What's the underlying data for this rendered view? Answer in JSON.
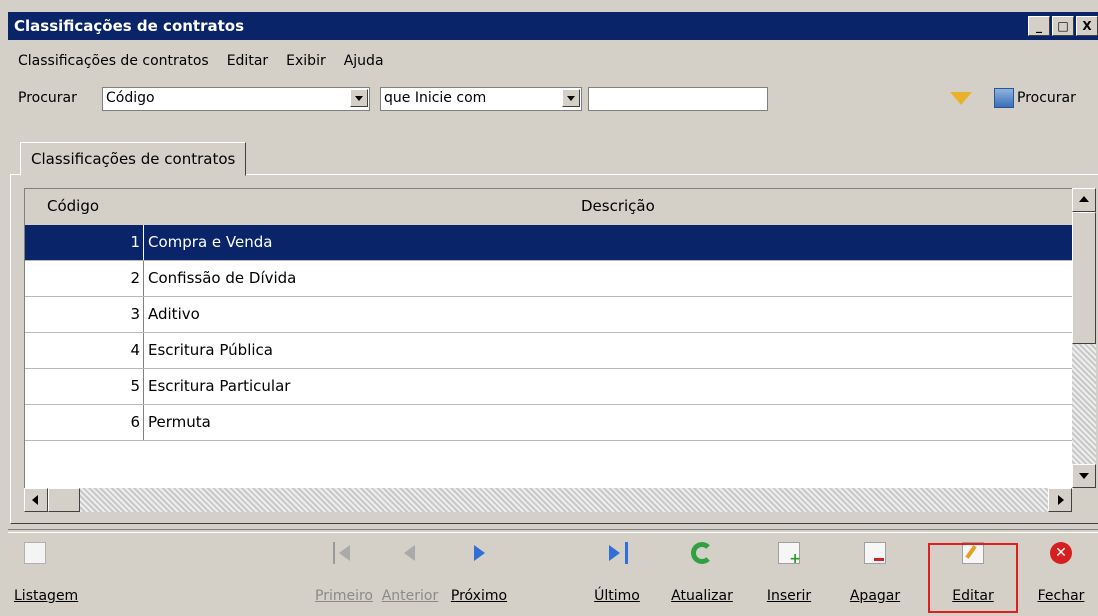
{
  "window": {
    "title": "Classificações de contratos",
    "controls": [
      "_",
      "□",
      "X"
    ]
  },
  "menu": {
    "items": [
      "Classificações de contratos",
      "Editar",
      "Exibir",
      "Ajuda"
    ]
  },
  "search": {
    "label": "Procurar",
    "field": "Código",
    "condition": "que Inicie com",
    "value": "",
    "button_label": "Procurar"
  },
  "tab": {
    "label": "Classificações de contratos"
  },
  "grid": {
    "columns": [
      "Código",
      "Descrição"
    ],
    "rows": [
      {
        "codigo": "1",
        "descricao": "Compra e Venda",
        "selected": true
      },
      {
        "codigo": "2",
        "descricao": "Confissão de Dívida"
      },
      {
        "codigo": "3",
        "descricao": "Aditivo"
      },
      {
        "codigo": "4",
        "descricao": "Escritura Pública"
      },
      {
        "codigo": "5",
        "descricao": "Escritura Particular"
      },
      {
        "codigo": "6",
        "descricao": "Permuta"
      }
    ]
  },
  "toolbar": {
    "listagem": "Listagem",
    "primeiro": "Primeiro",
    "anterior": "Anterior",
    "proximo": "Próximo",
    "ultimo": "Último",
    "atualizar": "Atualizar",
    "inserir": "Inserir",
    "apagar": "Apagar",
    "editar": "Editar",
    "fechar": "Fechar"
  },
  "colors": {
    "titlebar": "#0a246a",
    "selection": "#0a246a",
    "highlight_border": "#e02020"
  }
}
